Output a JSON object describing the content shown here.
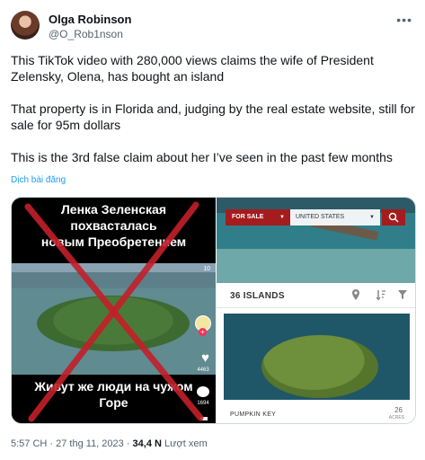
{
  "author": {
    "name": "Olga Robinson",
    "handle": "@O_Rob1nson"
  },
  "tweet": {
    "paragraphs": [
      "This TikTok video with 280,000 views claims the wife of President Zelensky, Olena, has bought an island",
      "That property is in Florida and, judging by the real estate website, still for sale for 95m dollars",
      "This is the 3rd false claim about her I’ve seen in the past few months"
    ],
    "translate_label": "Dịch bài đăng"
  },
  "tiktok": {
    "caption_top": [
      "Ленка Зеленская",
      "похвасталась",
      "новым Преобретением"
    ],
    "caption_bottom": [
      "Живут же люди на чужом",
      "Горе"
    ],
    "corner_number": "10",
    "likes": "4463",
    "comments": "1694"
  },
  "realestate": {
    "for_sale_label": "FOR SALE",
    "country_label": "UNITED STATES",
    "results_label": "36 ISLANDS",
    "listing_name": "PUMPKIN KEY",
    "acres_value": "26",
    "acres_label": "ACRES"
  },
  "footer": {
    "time": "5:57 CH · 27 thg 11, 2023 · ",
    "views": "34,4 N",
    "views_label": " Lượt xem"
  }
}
